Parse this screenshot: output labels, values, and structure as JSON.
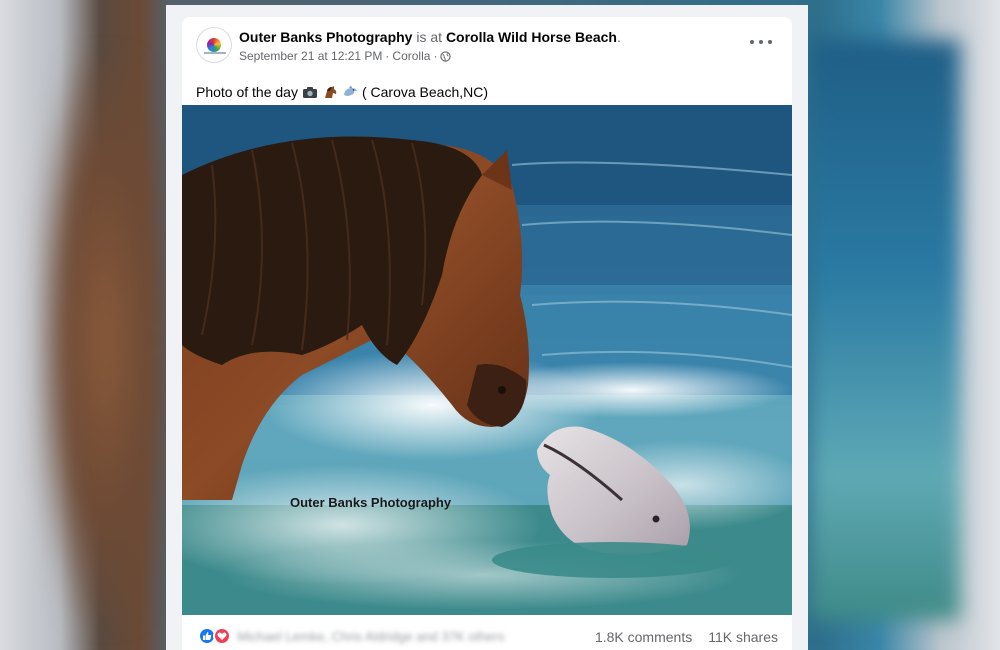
{
  "post": {
    "page_name": "Outer Banks Photography",
    "at_text": "is at",
    "location_name": "Corolla Wild Horse Beach",
    "location_suffix": ".",
    "timestamp": "September 21 at 12:21 PM",
    "separator": "·",
    "place": "Corolla",
    "audience_icon": "globe-icon",
    "caption_text": "Photo of the day",
    "caption_emojis": [
      "camera-emoji",
      "horse-emoji",
      "dolphin-emoji"
    ],
    "caption_location": "( Carova Beach,NC)",
    "photo_watermark": "Outer Banks Photography",
    "reactors": "Michael Lemke, Chris Aldridge and 37K others",
    "comments": "1.8K comments",
    "shares": "11K shares"
  },
  "colors": {
    "link_blue": "#1877f2",
    "love_red": "#f33e58",
    "meta_gray": "#65676b",
    "background": "#f0f2f5"
  }
}
